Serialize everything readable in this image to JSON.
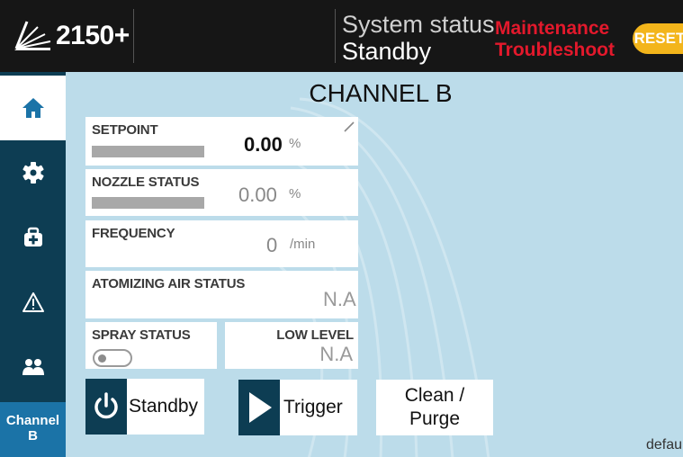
{
  "header": {
    "logo_text": "2150+",
    "status_label": "System status",
    "status_value": "Standby",
    "maintenance_line1": "Maintenance",
    "maintenance_line2": "Troubleshoot",
    "reset_label": "RESET"
  },
  "sidebar": {
    "items": [
      {
        "icon": "home-icon",
        "active": true
      },
      {
        "icon": "gear-icon"
      },
      {
        "icon": "medical-kit-icon"
      },
      {
        "icon": "warning-icon"
      },
      {
        "icon": "users-icon"
      }
    ],
    "channel_line1": "Channel",
    "channel_line2": "B"
  },
  "main": {
    "title": "CHANNEL B",
    "setpoint": {
      "label": "SETPOINT",
      "value": "0.00",
      "unit": "%"
    },
    "nozzle": {
      "label": "NOZZLE STATUS",
      "value": "0.00",
      "unit": "%"
    },
    "frequency": {
      "label": "FREQUENCY",
      "value": "0",
      "unit": "/min"
    },
    "atomizing": {
      "label": "ATOMIZING AIR STATUS",
      "value": "N.A"
    },
    "spray": {
      "label": "SPRAY STATUS",
      "on": false
    },
    "low_level": {
      "label": "LOW LEVEL",
      "value": "N.A"
    },
    "buttons": {
      "standby": "Standby",
      "trigger": "Trigger",
      "clean_line1": "Clean /",
      "clean_line2": "Purge"
    },
    "footer_text": "defaul"
  },
  "colors": {
    "header_bg": "#161616",
    "sidebar_bg": "#0d3d53",
    "channel_tab": "#1b73a7",
    "main_bg": "#bcdcea",
    "alert_red": "#e3192c",
    "reset_yellow": "#f3b51b"
  }
}
